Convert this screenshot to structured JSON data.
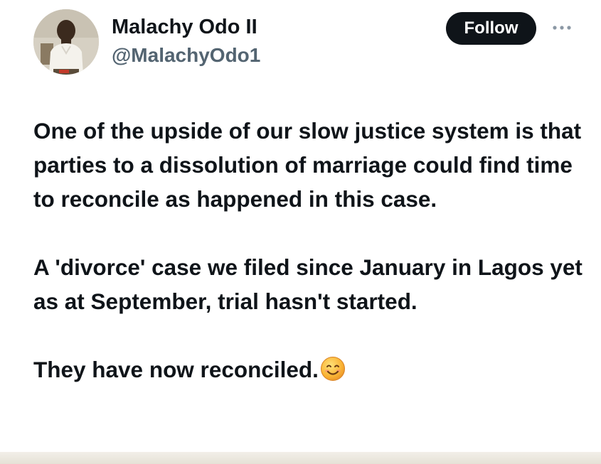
{
  "author": {
    "display_name": "Malachy Odo II",
    "handle": "@MalachyOdo1"
  },
  "actions": {
    "follow_label": "Follow"
  },
  "icons": {
    "avatar": "profile-photo",
    "more": "more-options-icon",
    "emoji": "smiling-face-emoji"
  },
  "tweet": {
    "paragraphs": [
      "One of the upside of our slow justice system is that parties to a dissolution of marriage could find time to reconcile as happened in this case.",
      "A 'divorce' case we filed since January in Lagos yet as at September, trial hasn't started.",
      "They have now reconciled."
    ]
  },
  "colors": {
    "text": "#0f1419",
    "secondary_text": "#536471",
    "button_bg": "#0f1419",
    "button_text": "#ffffff",
    "background": "#ffffff"
  }
}
